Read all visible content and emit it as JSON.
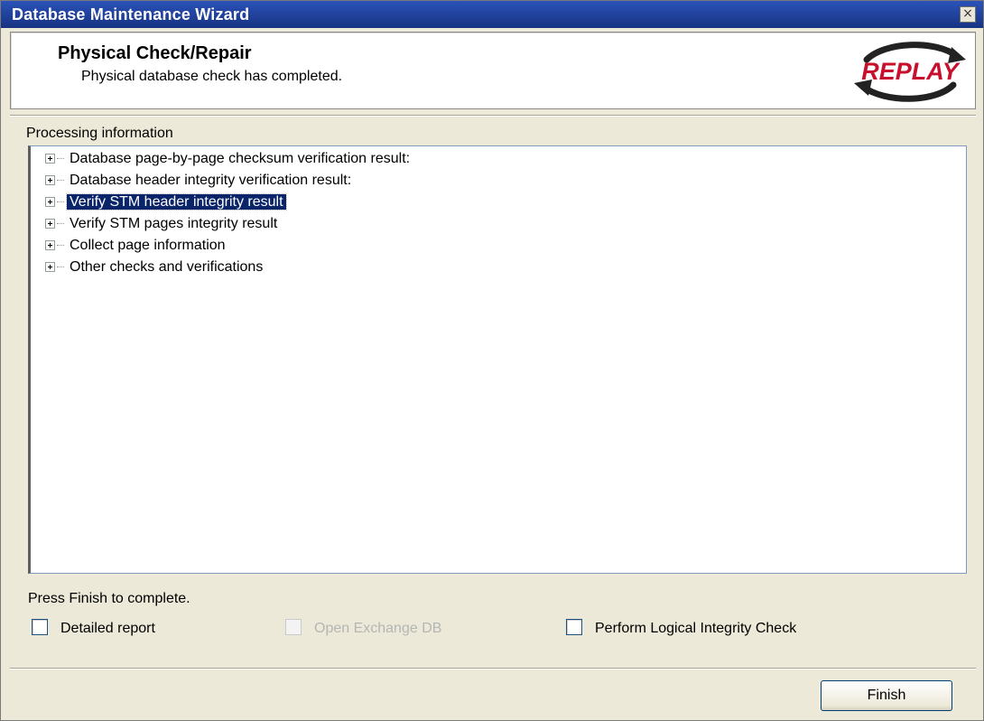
{
  "window": {
    "title": "Database Maintenance Wizard",
    "close_glyph": "×"
  },
  "header": {
    "title": "Physical Check/Repair",
    "subtitle": "Physical database check has completed.",
    "logo_text": "REPLAY",
    "logo_colors": {
      "text": "#c8102e",
      "arrows": "#222222"
    }
  },
  "processing": {
    "label": "Processing information",
    "items": [
      {
        "label": "Database page-by-page checksum verification result:",
        "selected": false
      },
      {
        "label": "Database header integrity verification result:",
        "selected": false
      },
      {
        "label": "Verify STM header integrity result",
        "selected": true
      },
      {
        "label": "Verify STM pages integrity result",
        "selected": false
      },
      {
        "label": "Collect page information",
        "selected": false
      },
      {
        "label": "Other checks and verifications",
        "selected": false
      }
    ]
  },
  "footer": {
    "hint": "Press Finish to complete.",
    "options": [
      {
        "label": "Detailed report",
        "checked": false,
        "enabled": true
      },
      {
        "label": "Open Exchange DB",
        "checked": false,
        "enabled": false
      },
      {
        "label": "Perform Logical Integrity Check",
        "checked": false,
        "enabled": true
      }
    ],
    "finish_label": "Finish"
  },
  "colors": {
    "selection": "#0a246a",
    "titlebar": "#1f3f98",
    "dialog_bg": "#ece9d8"
  }
}
